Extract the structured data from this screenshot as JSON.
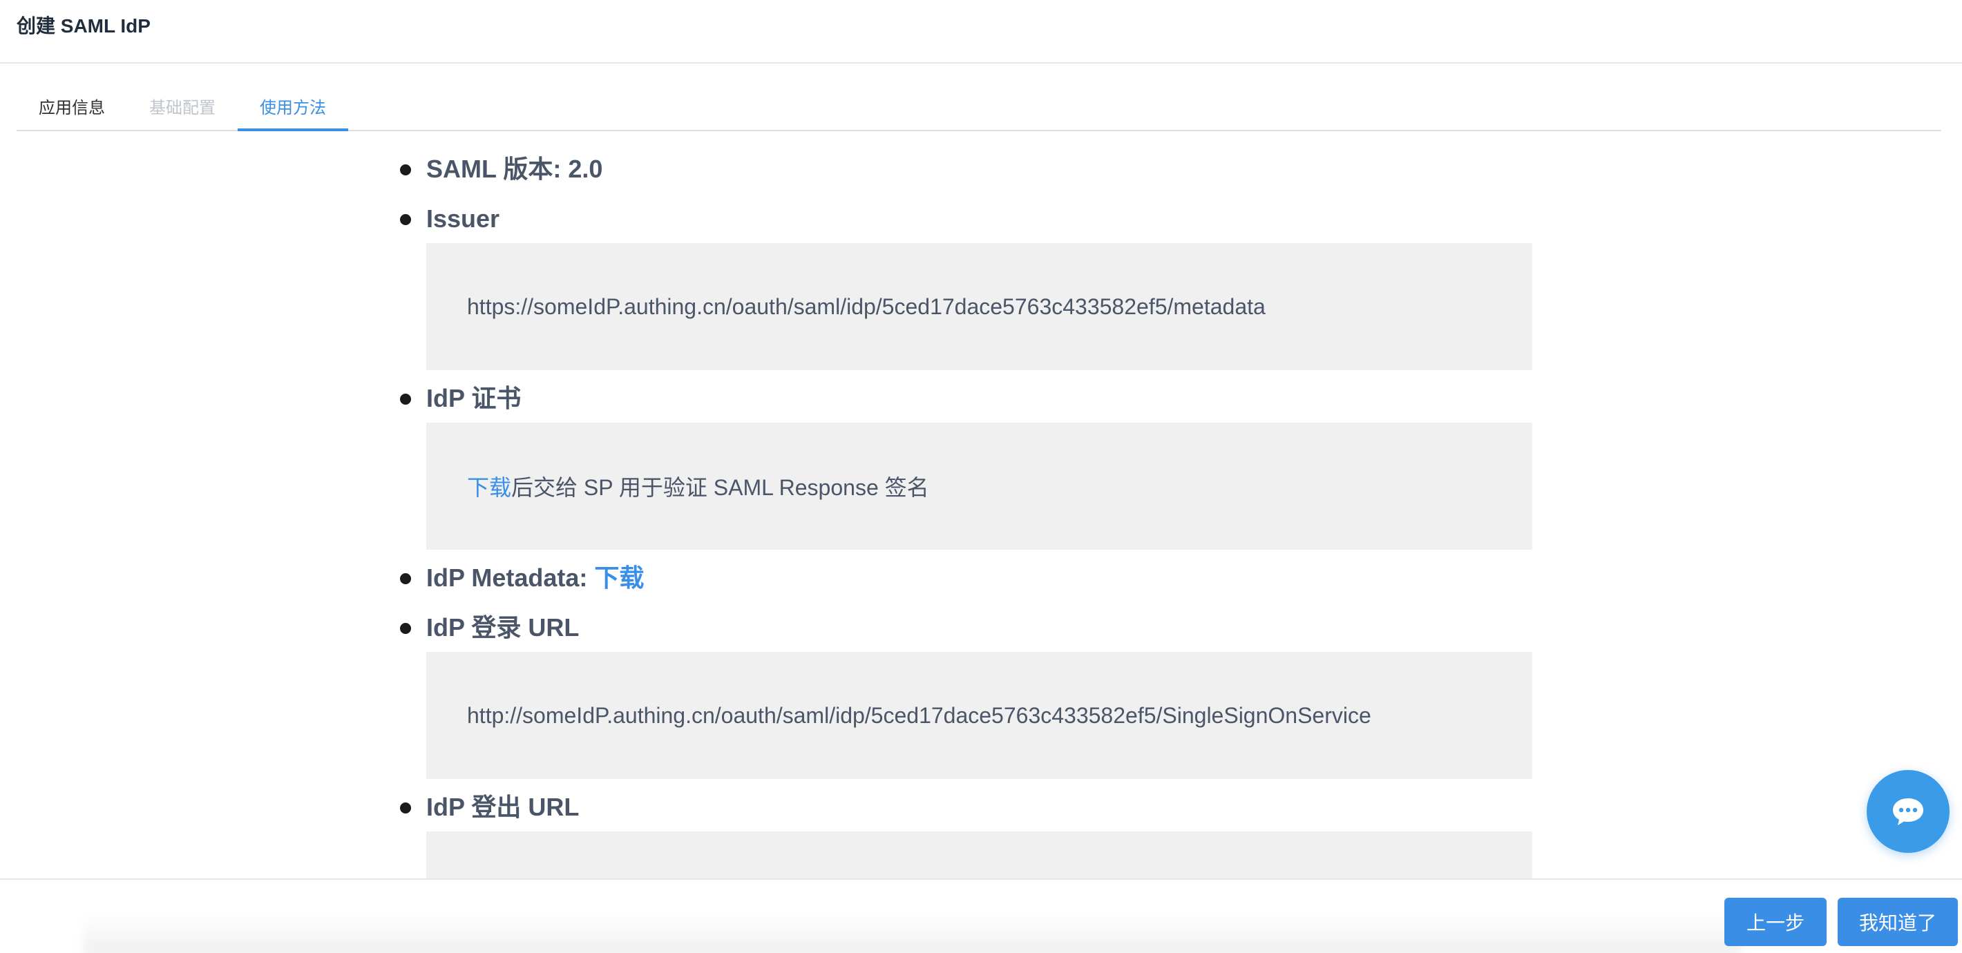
{
  "header": {
    "title": "创建 SAML IdP"
  },
  "tabs": [
    {
      "label": "应用信息",
      "state": "normal"
    },
    {
      "label": "基础配置",
      "state": "disabled"
    },
    {
      "label": "使用方法",
      "state": "active"
    }
  ],
  "content": {
    "saml_version": "SAML 版本: 2.0",
    "issuer": {
      "label": "Issuer",
      "value": "https://someIdP.authing.cn/oauth/saml/idp/5ced17dace5763c433582ef5/metadata"
    },
    "certificate": {
      "label": "IdP 证书",
      "link": "下载",
      "text": "后交给 SP 用于验证 SAML Response 签名"
    },
    "metadata": {
      "label": "IdP Metadata: ",
      "link": "下载"
    },
    "login_url": {
      "label": "IdP 登录 URL",
      "value": "http://someIdP.authing.cn/oauth/saml/idp/5ced17dace5763c433582ef5/SingleSignOnService"
    },
    "logout_url": {
      "label": "IdP 登出 URL",
      "value": ""
    }
  },
  "footer": {
    "prev_label": "上一步",
    "ok_label": "我知道了"
  },
  "icons": {
    "chat": "chat-bubble-icon"
  },
  "colors": {
    "accent": "#3a8ee6",
    "code_bg": "#f0f0f0",
    "disabled": "#c0c4cc"
  }
}
